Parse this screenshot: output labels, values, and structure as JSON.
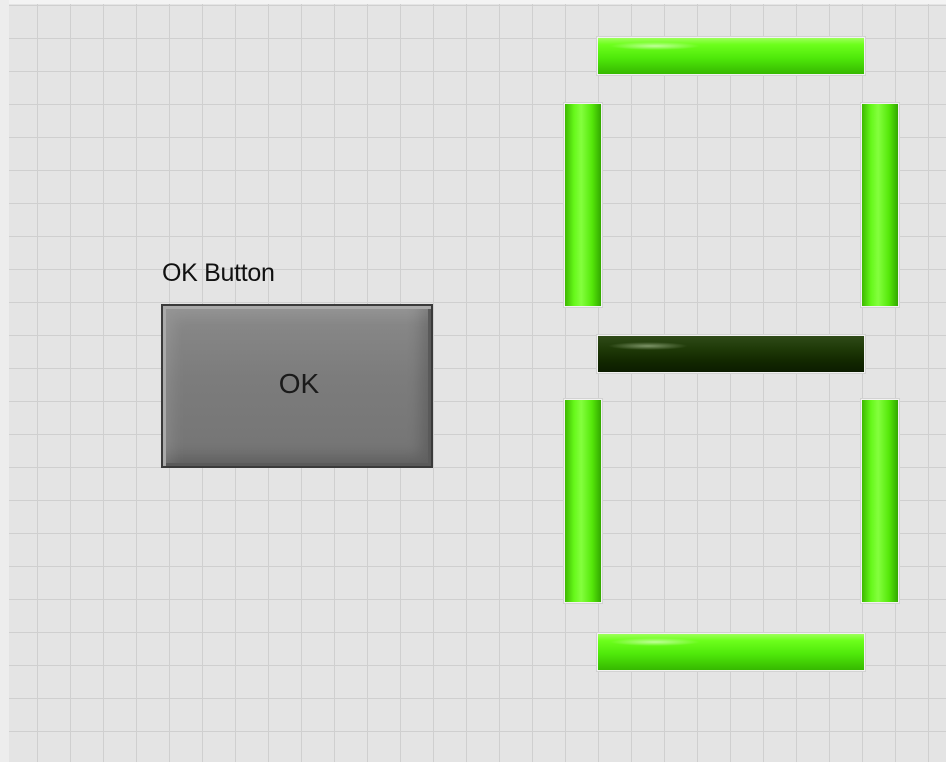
{
  "button": {
    "caption": "OK Button",
    "text": "OK"
  },
  "display": {
    "kind": "seven-segment indicator",
    "segments": {
      "a": true,
      "b": true,
      "c": true,
      "d": true,
      "e": true,
      "f": true,
      "g": false
    },
    "colors": {
      "on": "#66f81a",
      "off": "#122800",
      "panel": "#e4e4e4",
      "grid": "#cfcfcf",
      "button_face": "#7c7c7c"
    }
  }
}
